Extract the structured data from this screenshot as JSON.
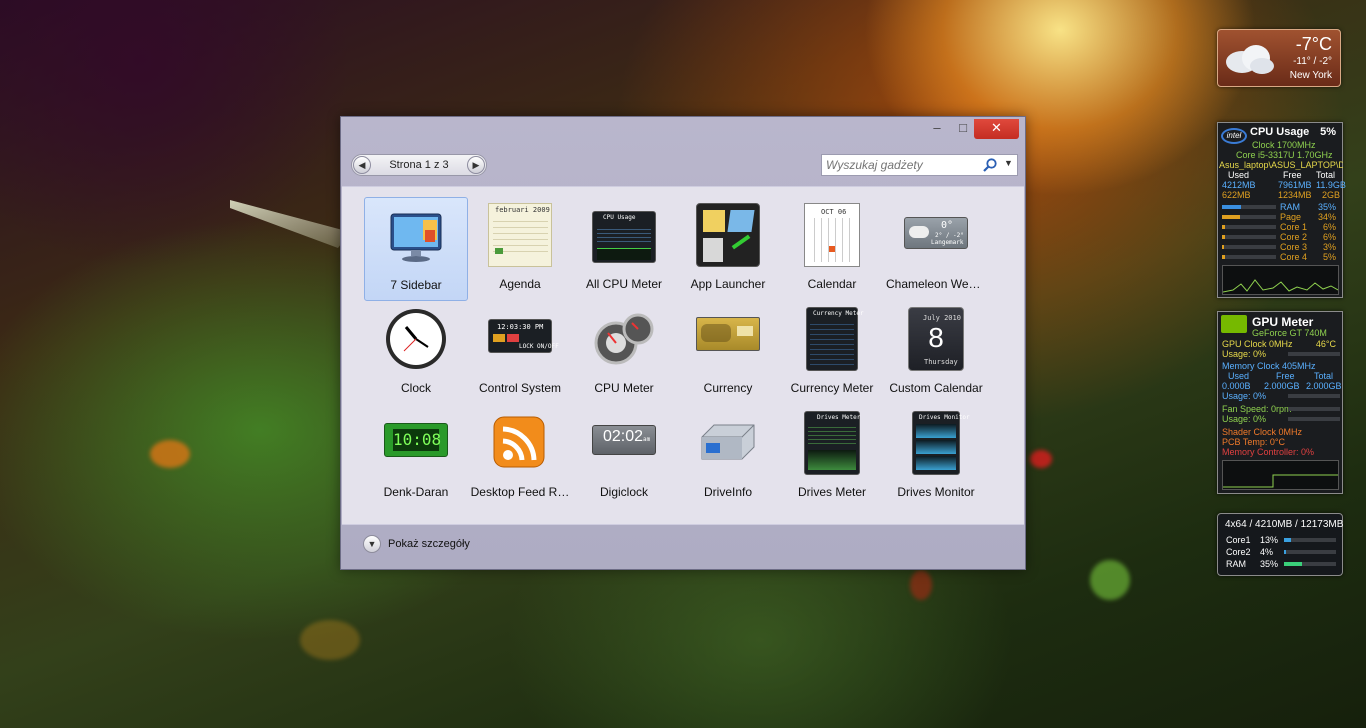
{
  "window": {
    "minimize_symbol": "–",
    "maximize_symbol": "□",
    "close_symbol": "✕",
    "pager_label": "Strona 1 z 3",
    "search_placeholder": "Wyszukaj gadżety",
    "details_label": "Pokaż szczegóły"
  },
  "gadgets": [
    {
      "label": "7 Sidebar",
      "icon": "sidebar-monitor-icon",
      "selected": true
    },
    {
      "label": "Agenda",
      "icon": "agenda-calendar-icon"
    },
    {
      "label": "All CPU Meter",
      "icon": "cpu-meter-panel-icon"
    },
    {
      "label": "App Launcher",
      "icon": "app-launcher-icon"
    },
    {
      "label": "Calendar",
      "icon": "calendar-icon"
    },
    {
      "label": "Chameleon Wea…",
      "icon": "weather-cloud-icon"
    },
    {
      "label": "Clock",
      "icon": "analog-clock-icon"
    },
    {
      "label": "Control System",
      "icon": "control-system-icon"
    },
    {
      "label": "CPU Meter",
      "icon": "cpu-dial-icon"
    },
    {
      "label": "Currency",
      "icon": "currency-card-icon"
    },
    {
      "label": "Currency Meter",
      "icon": "currency-meter-icon"
    },
    {
      "label": "Custom Calendar",
      "icon": "custom-calendar-icon"
    },
    {
      "label": "Denk-Daran",
      "icon": "digital-alarm-icon"
    },
    {
      "label": "Desktop Feed R…",
      "icon": "rss-feed-icon"
    },
    {
      "label": "Digiclock",
      "icon": "digiclock-icon"
    },
    {
      "label": "DriveInfo",
      "icon": "hard-drive-icon"
    },
    {
      "label": "Drives Meter",
      "icon": "drives-meter-icon"
    },
    {
      "label": "Drives Monitor",
      "icon": "drives-monitor-icon"
    }
  ],
  "thumb_text": {
    "agenda_month": "februari 2009",
    "cpu_title": "CPU Usage",
    "cal_month": "OCT 06",
    "wea_temp": "0°",
    "wea_range": "2° / -2°",
    "wea_city": "Langemark",
    "ctrl_time": "12:03:30 PM",
    "ctrl_lock": "LOCK ON/OFF",
    "currm_title": "Currency Meter",
    "custcal_month": "July 2010",
    "custcal_day": "8",
    "custcal_weekday": "Thursday",
    "denk_time": "10:08",
    "digi_time": "02:02",
    "digi_ampm": "am",
    "drvm_title": "Drives Meter",
    "drvmon_title": "Drives Monitor"
  },
  "weather_gadget": {
    "temp": "-7°C",
    "range": "-11° / -2°",
    "city": "New York"
  },
  "cpu_gadget": {
    "title": "CPU Usage",
    "percent": "5%",
    "clock": "Clock 1700MHz",
    "cpu_name": "Core i5-3317U 1.70GHz",
    "host": "Asus_laptop\\ASUS_LAPTOP\\Da",
    "headers": [
      "Used",
      "Free",
      "Total"
    ],
    "rows": [
      [
        "4212MB",
        "7961MB",
        "11.9GB"
      ],
      [
        "622MB",
        "1234MB",
        "2GB"
      ]
    ],
    "bars": [
      {
        "label": "RAM",
        "value": "35%",
        "fill": 0.35,
        "color": "#3a8fe0"
      },
      {
        "label": "Page",
        "value": "34%",
        "fill": 0.34,
        "color": "#e0a020"
      },
      {
        "label": "Core 1",
        "value": "6%",
        "fill": 0.06,
        "color": "#e0a020"
      },
      {
        "label": "Core 2",
        "value": "6%",
        "fill": 0.06,
        "color": "#e0a020"
      },
      {
        "label": "Core 3",
        "value": "3%",
        "fill": 0.03,
        "color": "#e0a020"
      },
      {
        "label": "Core 4",
        "value": "5%",
        "fill": 0.05,
        "color": "#e0a020"
      }
    ]
  },
  "gpu_gadget": {
    "title": "GPU Meter",
    "model": "GeForce GT 740M",
    "gpu_clock": "GPU Clock 0MHz",
    "gpu_temp": "46°C",
    "usage1": "Usage: 0%",
    "mem_clock": "Memory Clock 405MHz",
    "headers": [
      "Used",
      "Free",
      "Total"
    ],
    "mem_row": [
      "0.000B",
      "2.000GB",
      "2.000GB"
    ],
    "usage2": "Usage: 0%",
    "fan": "Fan Speed: 0rpm",
    "usage3": "Usage: 0%",
    "shader": "Shader Clock 0MHz",
    "pcb": "PCB Temp: 0°C",
    "mem_ctrl": "Memory Controller: 0%"
  },
  "mem_gadget": {
    "summary": "4x64 / 4210MB / 12173MB",
    "rows": [
      {
        "label": "Core1",
        "value": "13%",
        "fill": 0.13
      },
      {
        "label": "Core2",
        "value": "4%",
        "fill": 0.04
      },
      {
        "label": "RAM",
        "value": "35%",
        "fill": 0.35
      }
    ]
  },
  "colors": {
    "accent_close": "#c42d22",
    "cpu_green": "#8fd14f",
    "gpu_orange": "#f07a2a",
    "gpu_red": "#e04040",
    "gpu_blue": "#5ab0ff"
  }
}
